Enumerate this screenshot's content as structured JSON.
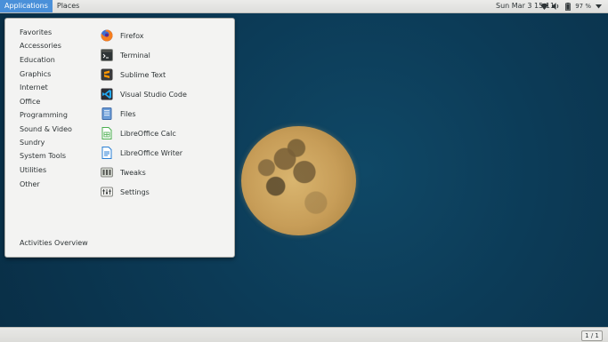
{
  "topbar": {
    "applications_label": "Applications",
    "places_label": "Places",
    "clock": "Sun Mar 3  15:11",
    "battery_percent": "97 %"
  },
  "menu": {
    "categories": [
      "Favorites",
      "Accessories",
      "Education",
      "Graphics",
      "Internet",
      "Office",
      "Programming",
      "Sound & Video",
      "Sundry",
      "System Tools",
      "Utilities",
      "Other"
    ],
    "apps": [
      {
        "label": "Firefox",
        "icon": "firefox-icon"
      },
      {
        "label": "Terminal",
        "icon": "terminal-icon"
      },
      {
        "label": "Sublime Text",
        "icon": "sublime-text-icon"
      },
      {
        "label": "Visual Studio Code",
        "icon": "vscode-icon"
      },
      {
        "label": "Files",
        "icon": "files-icon"
      },
      {
        "label": "LibreOffice Calc",
        "icon": "libreoffice-calc-icon"
      },
      {
        "label": "LibreOffice Writer",
        "icon": "libreoffice-writer-icon"
      },
      {
        "label": "Tweaks",
        "icon": "tweaks-icon"
      },
      {
        "label": "Settings",
        "icon": "settings-icon"
      }
    ],
    "activities_overview_label": "Activities Overview"
  },
  "bottombar": {
    "workspace_indicator": "1 / 1"
  },
  "colors": {
    "accent": "#4a90d9",
    "desktop": "#0c3b57",
    "moon": "#c79d58"
  }
}
